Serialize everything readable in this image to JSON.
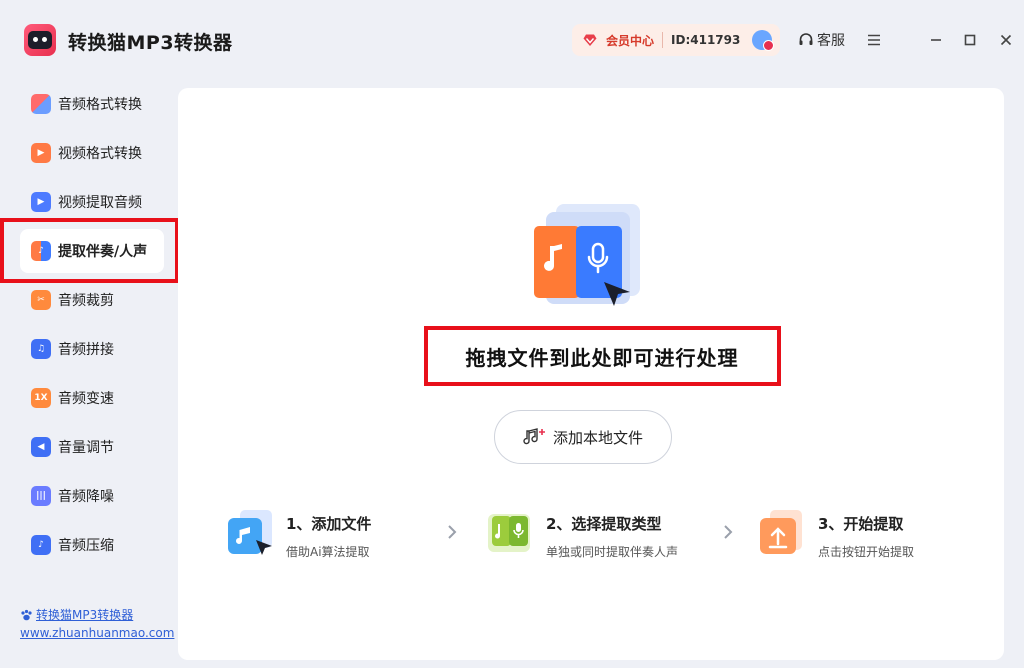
{
  "app": {
    "title": "转换猫MP3转换器"
  },
  "header": {
    "vip_label": "会员中心",
    "user_id": "ID:411793",
    "service_label": "客服",
    "accent_color": "#d63a2b"
  },
  "sidebar": {
    "items": [
      {
        "label": "音频格式转换",
        "icon": "audio-convert-icon",
        "color": "#5b8cff"
      },
      {
        "label": "视频格式转换",
        "icon": "video-convert-icon",
        "color": "#ff7a45"
      },
      {
        "label": "视频提取音频",
        "icon": "video-extract-icon",
        "color": "#4d7bff"
      },
      {
        "label": "提取伴奏/人声",
        "icon": "vocal-split-icon",
        "color": "#ff7a45",
        "active": true
      },
      {
        "label": "音频裁剪",
        "icon": "audio-cut-icon",
        "color": "#ff8a3d"
      },
      {
        "label": "音频拼接",
        "icon": "audio-merge-icon",
        "color": "#3f6ff5"
      },
      {
        "label": "音频变速",
        "icon": "speed-icon",
        "color": "#ff8a3d",
        "badge": "1X"
      },
      {
        "label": "音量调节",
        "icon": "volume-icon",
        "color": "#3f6ff5"
      },
      {
        "label": "音频降噪",
        "icon": "denoise-icon",
        "color": "#6a7cff"
      },
      {
        "label": "音频压缩",
        "icon": "compress-icon",
        "color": "#3f6ff5"
      }
    ],
    "brand_link": "转换猫MP3转换器",
    "brand_url": "www.zhuanhuanmao.com"
  },
  "main": {
    "drop_text": "拖拽文件到此处即可进行处理",
    "add_button": "添加本地文件",
    "steps": [
      {
        "title": "1、添加文件",
        "desc": "借助Ai算法提取"
      },
      {
        "title": "2、选择提取类型",
        "desc": "单独或同时提取伴奏人声"
      },
      {
        "title": "3、开始提取",
        "desc": "点击按钮开始提取"
      }
    ]
  }
}
